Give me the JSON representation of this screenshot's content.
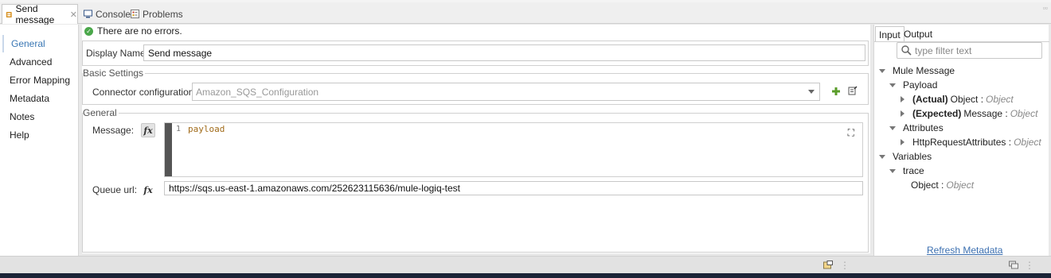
{
  "tabs": [
    {
      "label": "Send message",
      "icon": "mule-component-icon",
      "active": true
    },
    {
      "label": "Console",
      "icon": "console-icon"
    },
    {
      "label": "Problems",
      "icon": "problems-icon"
    }
  ],
  "nav": [
    "General",
    "Advanced",
    "Error Mapping",
    "Metadata",
    "Notes",
    "Help"
  ],
  "status": {
    "text": "There are no errors.",
    "color": "#4aa74a"
  },
  "display_name": {
    "label": "Display Name:",
    "value": "Send message"
  },
  "basic_settings": {
    "title": "Basic Settings",
    "connector_label": "Connector configuration:",
    "connector_value": "Amazon_SQS_Configuration"
  },
  "general": {
    "title": "General",
    "message_label": "Message:",
    "fx": "fx",
    "line_number": "1",
    "message_code": "payload",
    "queue_label": "Queue url:",
    "queue_value": "https://sqs.us-east-1.amazonaws.com/252623115636/mule-logiq-test"
  },
  "right_panel": {
    "tabs": [
      "Input",
      "Output"
    ],
    "filter_placeholder": "type filter text",
    "tree": {
      "mule_message": "Mule Message",
      "payload": "Payload",
      "actual_bold": "(Actual)",
      "actual_name": "Object :",
      "actual_type": "Object",
      "expected_bold": "(Expected)",
      "expected_name": "Message :",
      "expected_type": "Object",
      "attributes": "Attributes",
      "http_attr_name": "HttpRequestAttributes :",
      "http_attr_type": "Object",
      "variables": "Variables",
      "trace": "trace",
      "trace_obj_name": "Object :",
      "trace_obj_type": "Object"
    },
    "refresh_label": "Refresh Metadata"
  },
  "colors": {
    "accent": "#3a77b4",
    "link": "#3b6fb0",
    "code": "#a06a18",
    "add": "#5a9c2a"
  }
}
